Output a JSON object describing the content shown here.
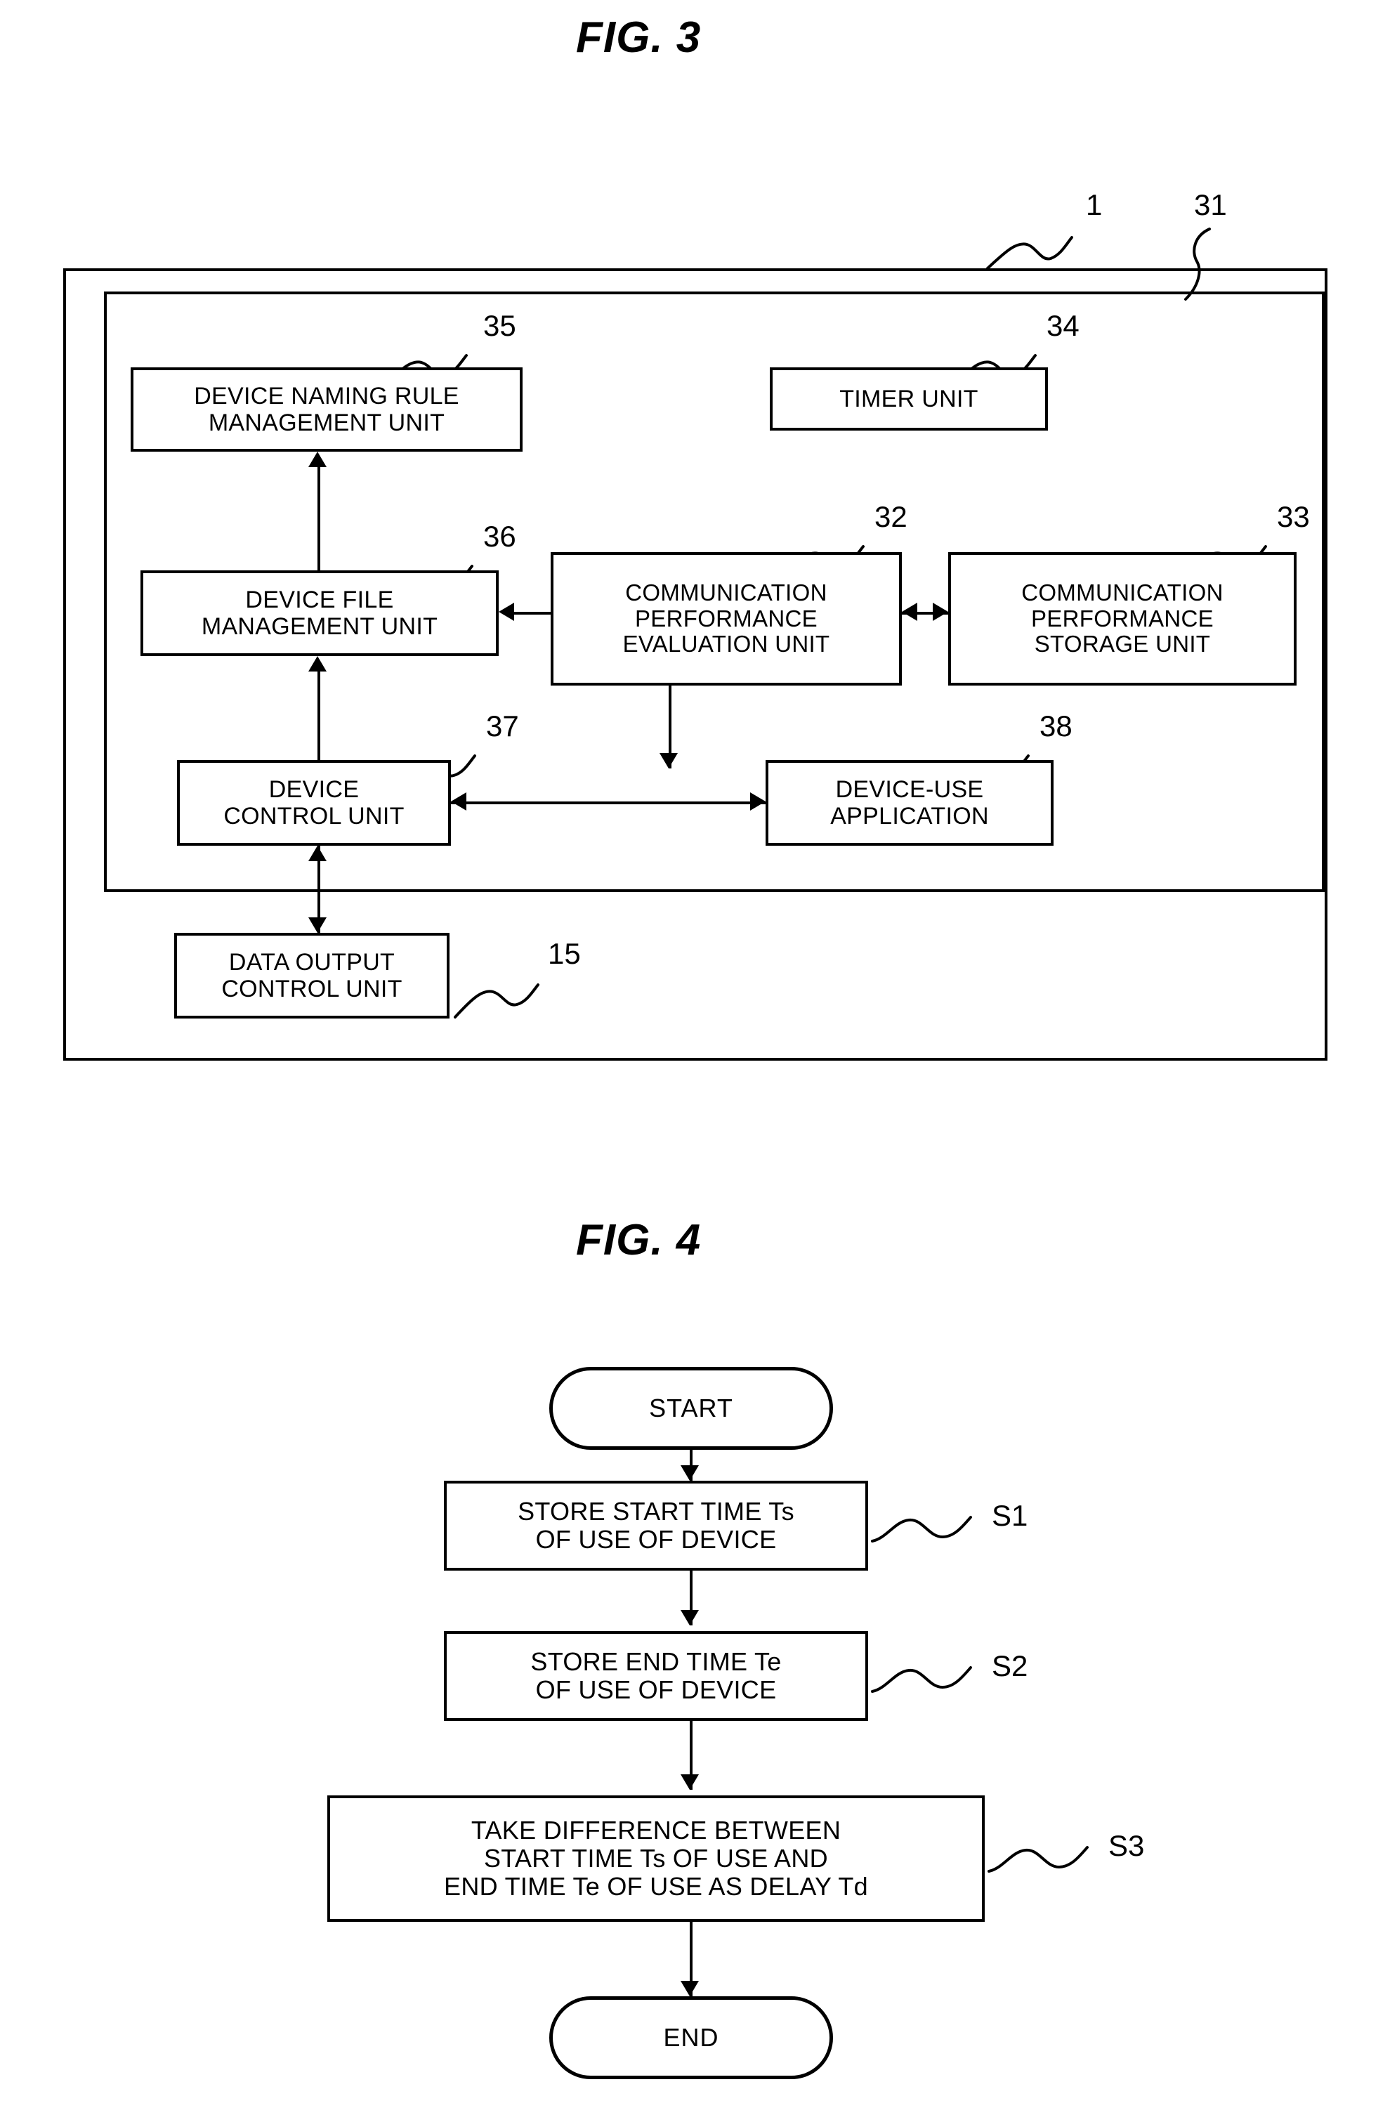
{
  "figures": [
    {
      "title": "FIG. 3",
      "type": "block-diagram",
      "refs": {
        "outer_system": "1",
        "inner_unit": "31",
        "naming_rule": "35",
        "timer": "34",
        "device_file": "36",
        "comm_eval": "32",
        "comm_storage": "33",
        "device_control": "37",
        "device_use_app": "38",
        "data_output": "15"
      },
      "blocks": {
        "naming_rule": "DEVICE NAMING RULE\nMANAGEMENT UNIT",
        "timer": "TIMER UNIT",
        "device_file": "DEVICE FILE\nMANAGEMENT UNIT",
        "comm_eval": "COMMUNICATION\nPERFORMANCE\nEVALUATION UNIT",
        "comm_storage": "COMMUNICATION\nPERFORMANCE\nSTORAGE UNIT",
        "device_control": "DEVICE\nCONTROL UNIT",
        "device_use_app": "DEVICE-USE\nAPPLICATION",
        "data_output": "DATA OUTPUT\nCONTROL UNIT"
      }
    },
    {
      "title": "FIG. 4",
      "type": "flowchart",
      "nodes": {
        "start": "START",
        "s1": "STORE START TIME Ts\nOF USE OF DEVICE",
        "s2": "STORE END TIME Te\nOF USE OF DEVICE",
        "s3": "TAKE DIFFERENCE BETWEEN\nSTART TIME Ts OF USE AND\nEND TIME Te OF USE AS DELAY Td",
        "end": "END"
      },
      "step_refs": {
        "s1": "S1",
        "s2": "S2",
        "s3": "S3"
      }
    }
  ],
  "colors": {
    "ink": "#000000",
    "paper": "#ffffff"
  }
}
